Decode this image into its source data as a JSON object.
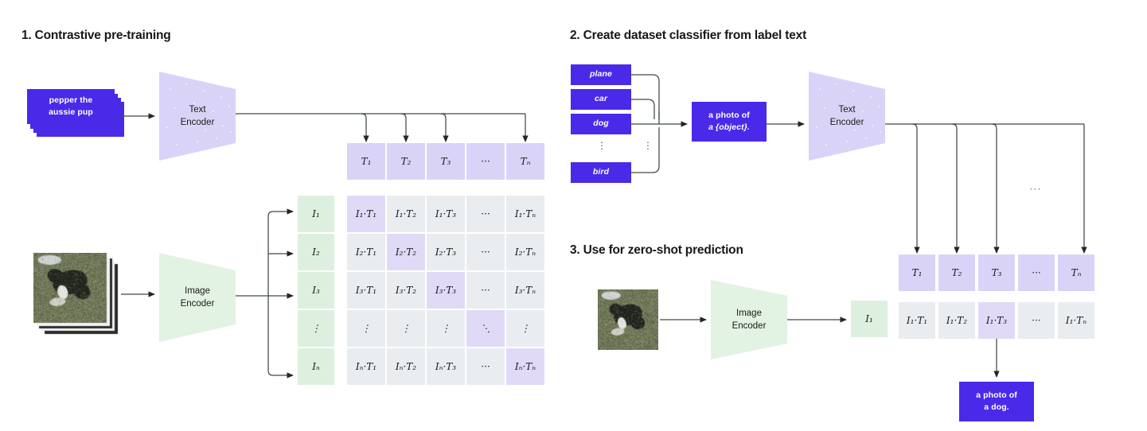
{
  "sections": [
    {
      "id": "s1",
      "title": "1. Contrastive pre-training"
    },
    {
      "id": "s2",
      "title": "2. Create dataset classifier from label text"
    },
    {
      "id": "s3",
      "title": "3. Use for zero-shot prediction"
    }
  ],
  "colors": {
    "blue": "#4a2ae8",
    "lavender_encoder": "#d9d4f7",
    "green_encoder": "#e2f2e3",
    "t_header": "#d9d4f7",
    "i_header": "#ddf0df",
    "cell_off_diagonal": "#e9edf0",
    "cell_on_diagonal": "#e0daf7",
    "text_dark": "#1a1a1a",
    "wire": "#3f4a42",
    "background": "#ffffff"
  },
  "section1": {
    "text_sample": "pepper the\naussie pup",
    "text_sample_line1": "pepper the",
    "text_sample_line2": "aussie pup",
    "text_encoder_label_line1": "Text",
    "text_encoder_label_line2": "Encoder",
    "image_encoder_label_line1": "Image",
    "image_encoder_label_line2": "Encoder",
    "image_stack_alt": "photo of aussie pup",
    "t_headers": [
      "T₁",
      "T₂",
      "T₃",
      "···",
      "Tₙ"
    ],
    "t_headers_plain": [
      "T1",
      "T2",
      "T3",
      "...",
      "TN"
    ],
    "i_headers": [
      "I₁",
      "I₂",
      "I₃",
      "⋮",
      "Iₙ"
    ],
    "i_headers_plain": [
      "I1",
      "I2",
      "I3",
      "vdots",
      "IN"
    ],
    "matrix": [
      [
        "I₁·T₁",
        "I₁·T₂",
        "I₁·T₃",
        "···",
        "I₁·Tₙ"
      ],
      [
        "I₂·T₁",
        "I₂·T₂",
        "I₂·T₃",
        "···",
        "I₂·Tₙ"
      ],
      [
        "I₃·T₁",
        "I₃·T₂",
        "I₃·T₃",
        "···",
        "I₃·Tₙ"
      ],
      [
        "⋮",
        "⋮",
        "⋮",
        "⋱",
        "⋮"
      ],
      [
        "Iₙ·T₁",
        "Iₙ·T₂",
        "Iₙ·T₃",
        "···",
        "Iₙ·Tₙ"
      ]
    ],
    "diagonal_highlight": [
      [
        0,
        0
      ],
      [
        1,
        1
      ],
      [
        2,
        2
      ],
      [
        3,
        3
      ],
      [
        4,
        4
      ]
    ],
    "column_ellipsis": "···",
    "row_ellipsis": "⋮"
  },
  "section2": {
    "labels": [
      "plane",
      "car",
      "dog",
      "bird"
    ],
    "labels_ellipsis": "⋮",
    "prompt_line1": "a photo of",
    "prompt_line2": "a {object}.",
    "prompt_full": "a photo of a {object}.",
    "text_encoder_label_line1": "Text",
    "text_encoder_label_line2": "Encoder",
    "t_headers": [
      "T₁",
      "T₂",
      "T₃",
      "···",
      "Tₙ"
    ],
    "bus_ellipsis": "···"
  },
  "section3": {
    "image_alt": "photo of a dog",
    "image_encoder_label_line1": "Image",
    "image_encoder_label_line2": "Encoder",
    "i_feature": "I₁",
    "row": [
      "I₁·T₁",
      "I₁·T₂",
      "I₁·T₃",
      "···",
      "I₁·Tₙ"
    ],
    "highlight_index": 2,
    "prediction_line1": "a photo of",
    "prediction_line2": "a dog.",
    "prediction_full": "a photo of a dog."
  }
}
